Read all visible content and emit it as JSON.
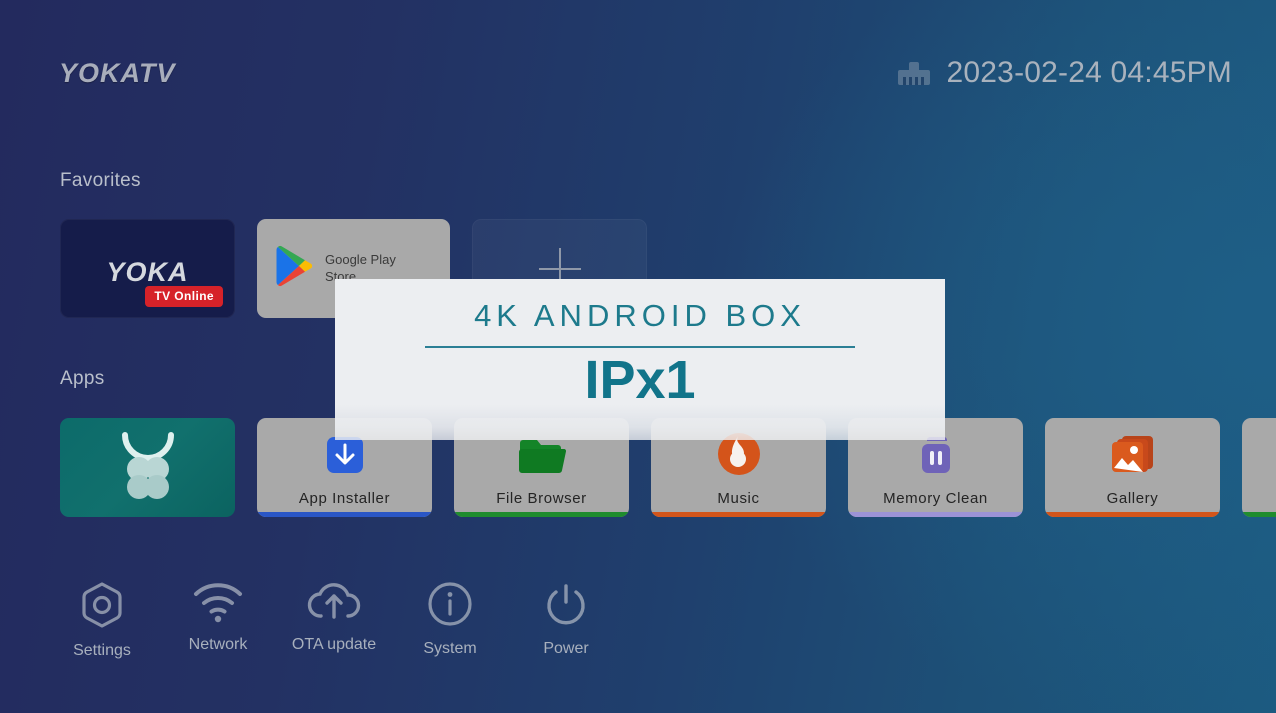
{
  "header": {
    "brand": "YOKATV",
    "network_icon": "ethernet-icon",
    "datetime": "2023-02-24 04:45PM"
  },
  "sections": {
    "favorites_label": "Favorites",
    "apps_label": "Apps"
  },
  "favorites": [
    {
      "name": "yoka-tv-online",
      "title": "YOKA",
      "badge": "TV Online",
      "bg_color": "#151c4a",
      "badge_color": "#d62229"
    },
    {
      "name": "google-play-store",
      "title": "Google Play Store",
      "icon": "google-play-icon",
      "bg_color": "#a9a9a9"
    },
    {
      "name": "add-favorite",
      "title": "+",
      "icon": "plus-icon"
    }
  ],
  "apps": [
    {
      "name": "app-store",
      "label": "",
      "icon": "app-store-bag-icon",
      "accent": "#0e6f6c",
      "featured": true
    },
    {
      "name": "app-installer",
      "label": "App  Installer",
      "icon": "download-box-icon",
      "accent": "#2a56c6"
    },
    {
      "name": "file-browser",
      "label": "File  Browser",
      "icon": "folder-icon",
      "accent": "#1f8c2e"
    },
    {
      "name": "music",
      "label": "Music",
      "icon": "music-circle-icon",
      "accent": "#d2551b"
    },
    {
      "name": "memory-clean",
      "label": "Memory  Clean",
      "icon": "trash-can-icon",
      "accent": "#9c93d6"
    },
    {
      "name": "gallery",
      "label": "Gallery",
      "icon": "photo-stack-icon",
      "accent": "#d2551b"
    },
    {
      "name": "partial-app",
      "label": "",
      "icon": "",
      "accent": "#1f8c2e"
    }
  ],
  "system": [
    {
      "name": "settings",
      "label": "Settings",
      "icon": "gear-hexagon-icon"
    },
    {
      "name": "network",
      "label": "Network",
      "icon": "wifi-icon"
    },
    {
      "name": "ota",
      "label": "OTA update",
      "icon": "cloud-upload-icon"
    },
    {
      "name": "system",
      "label": "System",
      "icon": "info-circle-icon"
    },
    {
      "name": "power",
      "label": "Power",
      "icon": "power-icon"
    }
  ],
  "promo": {
    "headline": "4K ANDROID BOX",
    "model": "IPx1",
    "accent_color": "#1d7a8c",
    "background": "#eceef1"
  }
}
